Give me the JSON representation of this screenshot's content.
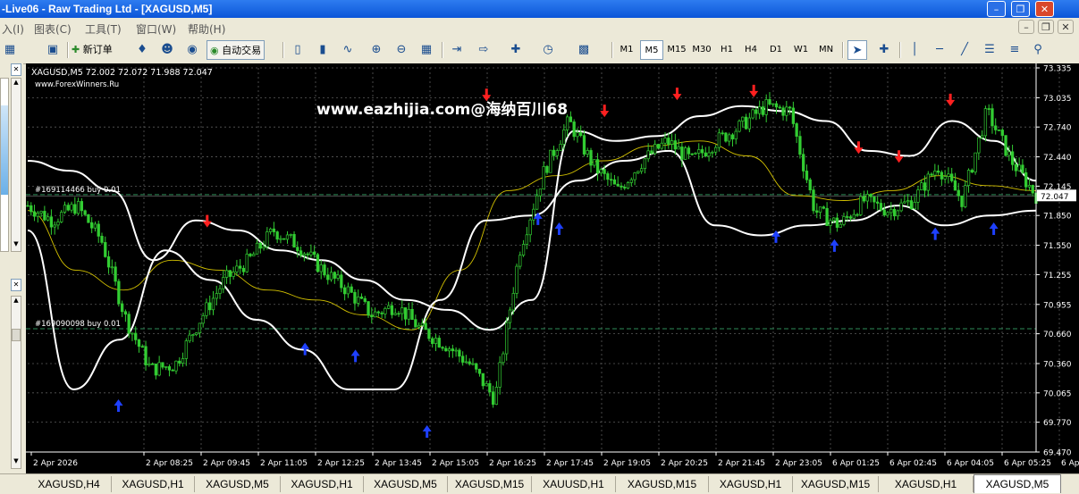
{
  "window": {
    "title": "-Live06 - Raw Trading Ltd - [XAGUSD,M5]"
  },
  "menu": [
    "入(I)",
    "图表(C)",
    "工具(T)",
    "窗口(W)",
    "帮助(H)"
  ],
  "toolbar": {
    "new_order": "新订单",
    "auto_trade": "自动交易",
    "timeframes": [
      "M1",
      "M5",
      "M15",
      "M30",
      "H1",
      "H4",
      "D1",
      "W1",
      "MN"
    ],
    "active_timeframe": "M5",
    "notification_count": "1"
  },
  "chart": {
    "symbol_line": "XAGUSD,M5  72.002 72.072 71.988 72.047",
    "source": "www.ForexWinners.Ru",
    "watermark": "www.eazhijia.com@海纳百川68",
    "current_price": "72.047",
    "orders": [
      {
        "label": "#169114466 buy 0.01",
        "price": 72.06
      },
      {
        "label": "#169090098 buy 0.01",
        "price": 70.71
      }
    ],
    "colors": {
      "background": "#000000",
      "grid": "#5a5a5a",
      "candle": "#32cd32",
      "bands": "#ffffff",
      "ma": "#d4c200",
      "sell_arrow": "#ff2020",
      "buy_arrow": "#1e40ff",
      "order_line": "#2e8b57"
    }
  },
  "chart_data": {
    "type": "line",
    "y_ticks": [
      "73.335",
      "73.035",
      "72.740",
      "72.440",
      "72.145",
      "71.850",
      "71.550",
      "71.255",
      "70.955",
      "70.660",
      "70.360",
      "70.065",
      "69.770",
      "69.470"
    ],
    "x_ticks": [
      "2 Apr 2026",
      "2 Apr 08:25",
      "2 Apr 09:45",
      "2 Apr 11:05",
      "2 Apr 12:25",
      "2 Apr 13:45",
      "2 Apr 15:05",
      "2 Apr 16:25",
      "2 Apr 17:45",
      "2 Apr 19:05",
      "2 Apr 20:25",
      "2 Apr 21:45",
      "2 Apr 23:05",
      "6 Apr 01:25",
      "6 Apr 02:45",
      "6 Apr 04:05",
      "6 Apr 05:25",
      "6 Apr 06:45"
    ],
    "ylim": [
      69.47,
      73.335
    ],
    "price": [
      71.95,
      71.8,
      71.95,
      71.6,
      70.8,
      70.3,
      70.35,
      70.8,
      71.2,
      71.4,
      71.7,
      71.55,
      71.3,
      71.1,
      70.85,
      70.95,
      70.7,
      70.55,
      70.35,
      70.0,
      71.5,
      72.3,
      72.8,
      72.35,
      72.1,
      72.4,
      72.6,
      72.4,
      72.6,
      72.75,
      72.95,
      72.9,
      71.9,
      71.75,
      72.0,
      71.9,
      72.0,
      72.35,
      72.0,
      72.9,
      72.4,
      72.05
    ],
    "upper_band": [
      72.4,
      72.3,
      72.1,
      71.4,
      71.8,
      71.7,
      71.5,
      71.4,
      71.2,
      71.0,
      70.9,
      70.7,
      71.0,
      72.7,
      72.6,
      72.65,
      72.85,
      72.95,
      72.9,
      72.8,
      72.5,
      72.45,
      72.8,
      72.6,
      72.2
    ],
    "lower_band": [
      71.7,
      70.1,
      70.6,
      71.5,
      71.2,
      70.8,
      70.5,
      70.1,
      70.1,
      71.0,
      71.8,
      71.85,
      72.2,
      72.4,
      72.5,
      71.75,
      71.65,
      71.75,
      71.8,
      71.95,
      71.75,
      71.85,
      71.9
    ],
    "ma": [
      71.9,
      71.3,
      71.1,
      71.4,
      71.3,
      71.1,
      71.0,
      70.85,
      70.7,
      71.3,
      72.1,
      72.25,
      72.4,
      72.55,
      72.6,
      72.45,
      72.05,
      72.0,
      72.1,
      72.25,
      72.15,
      72.1
    ],
    "sell_arrows": [
      [
        0.178,
        71.73
      ],
      [
        0.455,
        73.0
      ],
      [
        0.572,
        72.84
      ],
      [
        0.644,
        73.01
      ],
      [
        0.72,
        73.04
      ],
      [
        0.824,
        72.47
      ],
      [
        0.864,
        72.38
      ],
      [
        0.915,
        72.95
      ]
    ],
    "buy_arrows": [
      [
        0.09,
        70.0
      ],
      [
        0.275,
        70.57
      ],
      [
        0.325,
        70.5
      ],
      [
        0.396,
        69.74
      ],
      [
        0.506,
        71.88
      ],
      [
        0.527,
        71.78
      ],
      [
        0.742,
        71.7
      ],
      [
        0.8,
        71.61
      ],
      [
        0.9,
        71.73
      ],
      [
        0.958,
        71.78
      ]
    ]
  },
  "tabs": [
    "XAGUSD,H4",
    "XAGUSD,H1",
    "XAGUSD,M5",
    "XAGUSD,H1",
    "XAGUSD,M5",
    "XAGUSD,M15",
    "XAUUSD,H1",
    "XAGUSD,M15",
    "XAGUSD,H1",
    "XAGUSD,M15",
    "XAGUSD,H1",
    "XAGUSD,M5"
  ],
  "active_tab": 11
}
